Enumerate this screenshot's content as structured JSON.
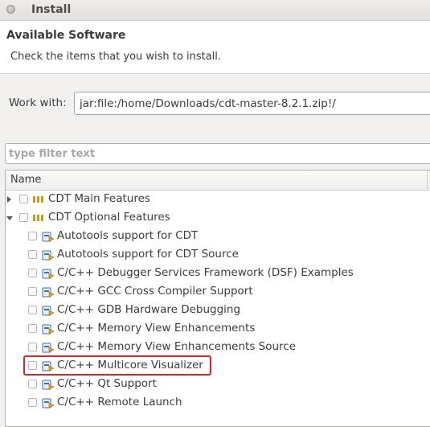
{
  "window": {
    "title": "Install"
  },
  "header": {
    "title": "Available Software",
    "description": "Check the items that you wish to install."
  },
  "work_with": {
    "label": "Work with:",
    "value": "jar:file:/home/Downloads/cdt-master-8.2.1.zip!/"
  },
  "filter": {
    "placeholder": "type filter text"
  },
  "tree": {
    "column_header": "Name",
    "categories": [
      {
        "label": "CDT Main Features",
        "expanded": false,
        "checked": false
      },
      {
        "label": "CDT Optional Features",
        "expanded": true,
        "checked": false
      }
    ],
    "features": [
      {
        "label": "Autotools support for CDT",
        "checked": false
      },
      {
        "label": "Autotools support for CDT Source",
        "checked": false
      },
      {
        "label": "C/C++ Debugger Services Framework (DSF) Examples",
        "checked": false
      },
      {
        "label": "C/C++ GCC Cross Compiler Support",
        "checked": false
      },
      {
        "label": "C/C++ GDB Hardware Debugging",
        "checked": false
      },
      {
        "label": "C/C++ Memory View Enhancements",
        "checked": false
      },
      {
        "label": "C/C++ Memory View Enhancements Source",
        "checked": false
      },
      {
        "label": "C/C++ Multicore Visualizer",
        "checked": false,
        "highlighted": true
      },
      {
        "label": "C/C++ Qt Support",
        "checked": false
      },
      {
        "label": "C/C++ Remote Launch",
        "checked": false
      }
    ]
  },
  "colors": {
    "highlight_border": "#d6262a",
    "category_icon": "#c99a1e",
    "feature_icon_blue": "#3d6fb5",
    "feature_icon_gold": "#d9a420"
  }
}
